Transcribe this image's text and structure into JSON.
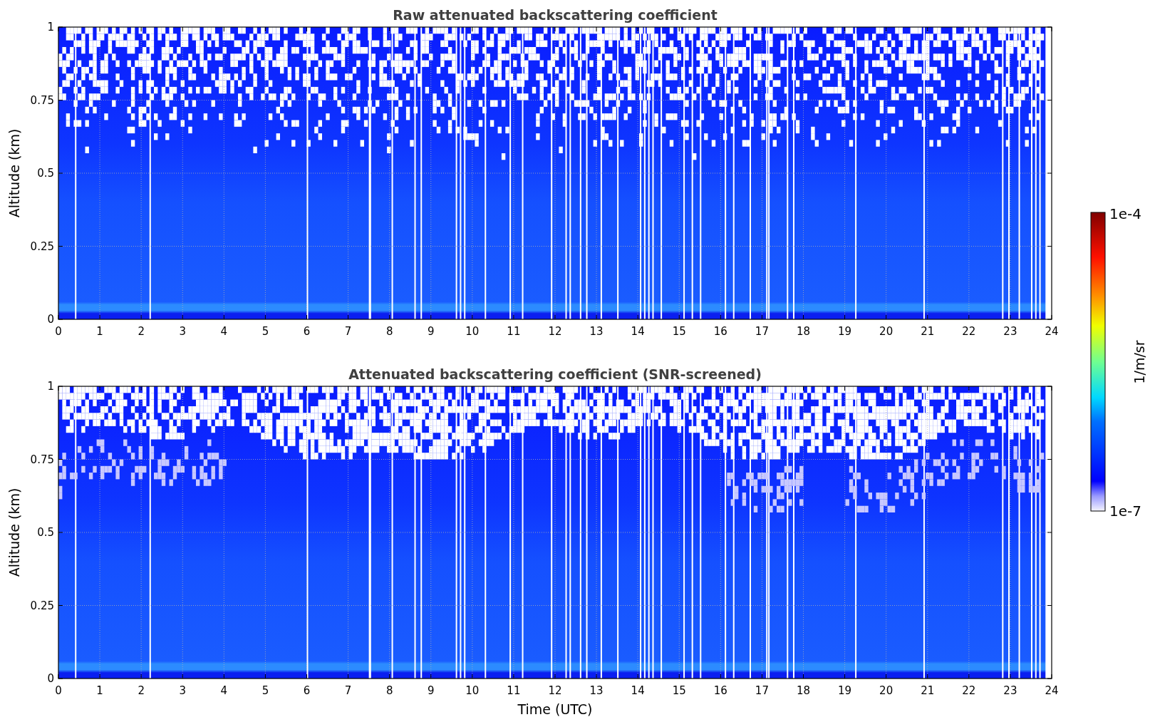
{
  "panels": [
    {
      "title": "Raw attenuated backscattering coefficient",
      "ylabel": "Altitude (km)",
      "yticks": [
        "1",
        "0.75",
        "0.5",
        "0.25",
        "0"
      ],
      "xticks": [
        "0",
        "1",
        "2",
        "3",
        "4",
        "5",
        "6",
        "7",
        "8",
        "9",
        "10",
        "11",
        "12",
        "13",
        "14",
        "15",
        "16",
        "17",
        "18",
        "19",
        "20",
        "21",
        "22",
        "23",
        "24"
      ],
      "screened": false
    },
    {
      "title": "Attenuated backscattering coefficient (SNR-screened)",
      "ylabel": "Altitude (km)",
      "yticks": [
        "1",
        "0.75",
        "0.5",
        "0.25",
        "0"
      ],
      "xticks": [
        "0",
        "1",
        "2",
        "3",
        "4",
        "5",
        "6",
        "7",
        "8",
        "9",
        "10",
        "11",
        "12",
        "13",
        "14",
        "15",
        "16",
        "17",
        "18",
        "19",
        "20",
        "21",
        "22",
        "23",
        "24"
      ],
      "xlabel": "Time (UTC)",
      "screened": true
    }
  ],
  "colorbar": {
    "max_label": "1e-4",
    "min_label": "1e-7",
    "label": "1/m/sr"
  }
}
